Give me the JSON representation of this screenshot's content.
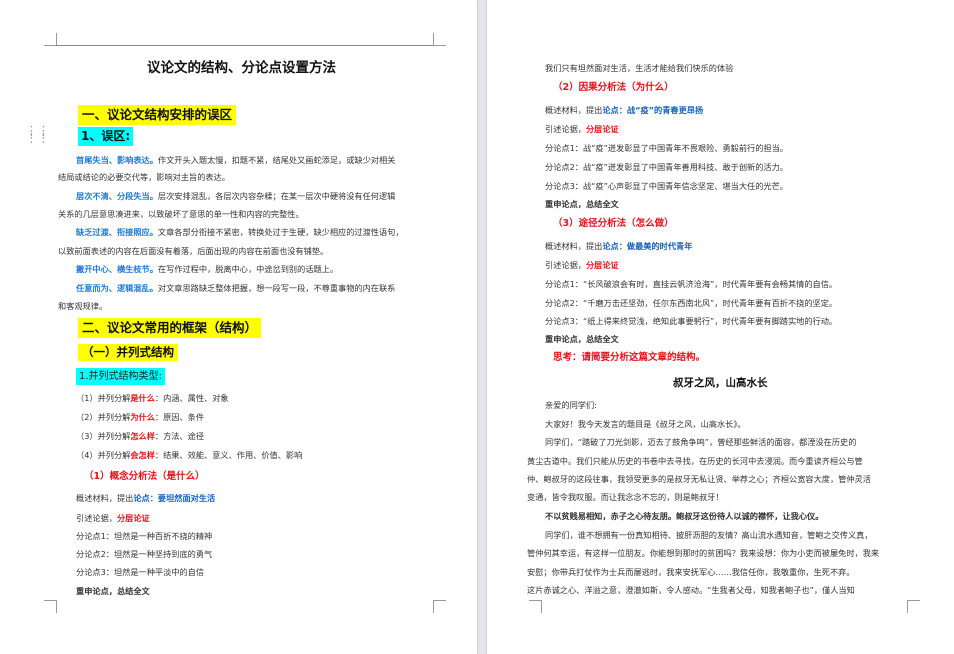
{
  "left_page": {
    "title": "议论文的结构、分论点设置方法",
    "section1_heading": "一、议论文结构安排的误区",
    "sub1_heading": "1、误区:",
    "errors": [
      {
        "key": "首尾失当、影响表达。",
        "text": "作文开头入题太慢，扣题不紧，结尾处又画蛇添足，或缺少对相关"
      },
      {
        "key": "",
        "text": "结局或结论的必要交代等，影响对主旨的表达。"
      },
      {
        "key": "层次不清、分段失当。",
        "text": "层次安排混乱，各层次内容杂糅；在某一层次中硬将没有任何逻辑"
      },
      {
        "key": "",
        "text": "关系的几层意思凑进来，以致破坏了意思的单一性和内容的完整性。"
      },
      {
        "key": "缺乏过渡、衔接照应。",
        "text": "文章各部分衔接不紧密，转换处过于生硬，缺少相应的过渡性语句，"
      },
      {
        "key": "",
        "text": "以致前面表述的内容在后面没有着落，后面出现的内容在前面也没有铺垫。"
      },
      {
        "key": "撇开中心、横生枝节。",
        "text": "在写作过程中，脱离中心，中途岔到别的话题上。"
      },
      {
        "key": "任意而为、逻辑混乱。",
        "text": "对文章思路缺乏整体把握，想一段写一段，不尊重事物的内在联系"
      },
      {
        "key": "",
        "text": "和客观规律。"
      }
    ],
    "section2_heading": "二、议论文常用的框架（结构）",
    "sub2_heading": "（一）并列式结构",
    "sub2_1": "1.并列式结构类型:",
    "types": [
      {
        "prefix": "（1）并列分解",
        "key": "是什么",
        "suffix": "：内涵、属性、对象"
      },
      {
        "prefix": "（2）并列分解",
        "key": "为什么",
        "suffix": "：原因、条件"
      },
      {
        "prefix": "（3）并列分解",
        "key": "怎么样",
        "suffix": "：方法、途径"
      },
      {
        "prefix": "（4）并列分解",
        "key": "会怎样",
        "suffix": "：结果、效能、意义、作用、价值、影响"
      }
    ],
    "method1_heading": "（1）概念分析法（是什么）",
    "method1": {
      "material_prefix": "概述材料，提出",
      "material_key": "论点：要坦然面对生活",
      "lead_prefix": "引述论据，",
      "lead_key": "分层论证",
      "points": [
        "分论点1：坦然是一种百折不挠的精神",
        "分论点2：坦然是一种坚持到底的勇气",
        "分论点3：坦然是一种平淡中的自信"
      ],
      "end": "重申论点，总结全文"
    }
  },
  "right_page": {
    "top_line": "我们只有坦然面对生活，生活才能给我们快乐的体验",
    "method2_heading": "（2）因果分析法（为什么）",
    "method2": {
      "material_prefix": "概述材料，提出",
      "material_key": "论点：战“疫”的青春更昂扬",
      "lead_prefix": "引述论据，",
      "lead_key": "分层论证",
      "points": [
        "分论点1：战“疫”迸发彰显了中国青年不畏艰险、勇毅前行的担当。",
        "分论点2：战“疫”迸发彰显了中国青年善用科技、敢于创新的活力。",
        "分论点3：战“疫”心声彰显了中国青年信念坚定、堪当大任的光芒。"
      ],
      "end": "重申论点，总结全文"
    },
    "method3_heading": "（3）途径分析法（怎么做）",
    "method3": {
      "material_prefix": "概述材料，提出",
      "material_key": "论点：做最美的时代青年",
      "lead_prefix": "引述论据，",
      "lead_key": "分层论证",
      "points": [
        "分论点1：“长风破浪会有时，直挂云帆济沧海”，时代青年要有会畅其情的自信。",
        "分论点2：“千磨万击还坚劲，任尔东西南北风”，时代青年要有百折不挠的坚定。",
        "分论点3：“纸上得来终觉浅，绝知此事要躬行”，时代青年要有脚踏实地的行动。"
      ],
      "end": "重申论点，总结全文"
    },
    "think": "思考：请简要分析这篇文章的结构。",
    "essay_title": "叔牙之风，山高水长",
    "essay_lines": [
      "亲爱的同学们:",
      "大家好！我今天发言的题目是《叔牙之风，山高水长》。",
      "同学们，“踏破了刀光剑影，迈去了鼓角争鸣”，曾经那些鲜活的面容，都湮没在历史的",
      "黄尘古道中。我们只能从历史的书卷中去寻找，在历史的长河中去浸润。而今重读齐桓公与管",
      "仲、鲍叔牙的这段往事，我领受更多的是叔牙无私让贤、举荐之心；齐桓公宽容大度，管仲灵活",
      "变通，皆令我叹服。而让我念念不忘的，则是鲍叔牙！"
    ],
    "essay_thesis": "不以贫贱易相知，赤子之心待友朋。鲍叔牙这份待人以诚的襟怀，让我心仪。",
    "essay_tail": [
      "同学们，谁不想拥有一份真知相待、披肝沥胆的友情？高山流水遇知音，管鲍之交传义真，",
      "管仲何其幸运，有这样一位朋友。你能想到那时的贫困吗？我来设想：你为小吏而被屡免时，我来",
      "安慰；你带兵打仗作为士兵而屡逃时，我来安抚军心……我信任你，我敬重你，生死不弃。",
      "这片赤诚之心、洋溢之意，澄澈如斯，令人感动。“生我者父母，知我者鲍子也”，僅人当知"
    ]
  },
  "colors": {
    "yellow": "#ffff00",
    "cyan": "#00ffff",
    "red": "#e8111a",
    "blue": "#1d7ad8",
    "green": "#3aa640"
  }
}
